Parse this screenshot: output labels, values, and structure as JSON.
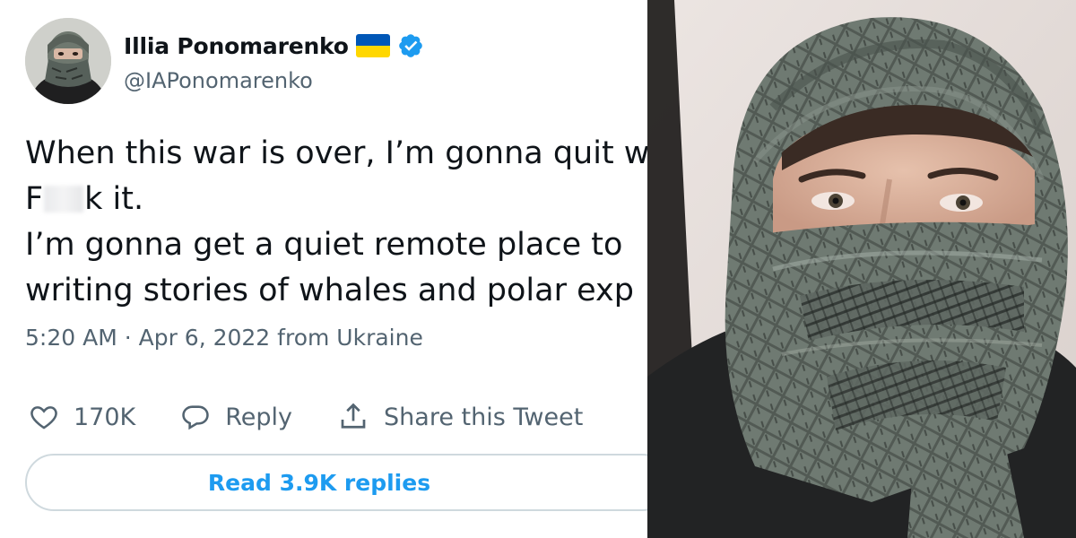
{
  "tweet": {
    "author": {
      "display_name": "Illia Ponomarenko",
      "handle": "@IAPonomarenko",
      "verified": true,
      "flag_colors": [
        "#0057b7",
        "#ffd700"
      ]
    },
    "text_lines": [
      "When this war is over, I’m gonna quit w",
      "k it.",
      "I’m gonna get a quiet remote place to",
      "writing stories of whales and polar exp"
    ],
    "censored_word_start": "F",
    "timestamp": "5:20 AM · Apr 6, 2022 from Ukraine",
    "actions": {
      "like_count": "170K",
      "reply_label": "Reply",
      "share_label": "Share this Tweet"
    },
    "read_replies_label": "Read 3.9K replies",
    "colors": {
      "text": "#0f1419",
      "secondary": "#536471",
      "accent": "#1d9bf0",
      "border": "#cfd9de"
    }
  },
  "photo": {
    "icons": [
      "person-in-shemagh-photo"
    ]
  }
}
